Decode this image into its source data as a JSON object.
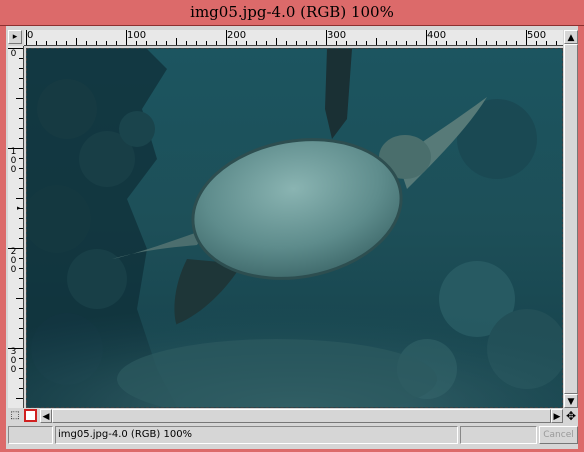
{
  "window": {
    "title": "img05.jpg-4.0 (RGB) 100%"
  },
  "menu": {
    "icon": "triangle-right-icon",
    "glyph": "▸"
  },
  "hruler": {
    "labels": [
      "0",
      "100",
      "200",
      "300",
      "400",
      "500"
    ]
  },
  "vruler": {
    "labels": [
      "0",
      "100",
      "200",
      "300"
    ]
  },
  "canvas": {
    "image_subject": "sea turtle underwater",
    "colors": {
      "water": "#1a4a55",
      "deep": "#0f2f38",
      "shell": "#6a9a9a"
    }
  },
  "status": {
    "text": "img05.jpg-4.0 (RGB) 100%",
    "cancel_label": "Cancel"
  },
  "icons": {
    "up_arrow": "▲",
    "down_arrow": "▼",
    "left_arrow": "◀",
    "right_arrow": "▶",
    "navigate": "✥",
    "qmask_toggle": "⬚"
  }
}
